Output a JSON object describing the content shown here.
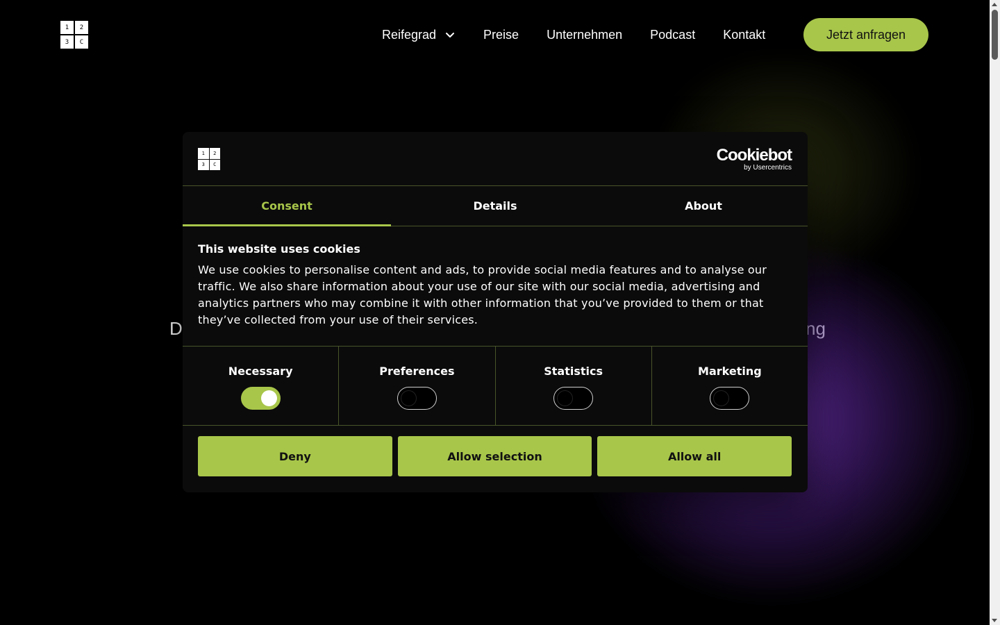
{
  "logo": {
    "cells": [
      "1",
      "2",
      "3",
      "C"
    ]
  },
  "nav": {
    "items": [
      "Reifegrad",
      "Preise",
      "Unternehmen",
      "Podcast",
      "Kontakt"
    ],
    "cta": "Jetzt anfragen"
  },
  "background": {
    "text_left": "D",
    "text_right": "ng"
  },
  "cookie_dialog": {
    "brand": "Cookiebot",
    "brand_by": "by Usercentrics",
    "tabs": [
      "Consent",
      "Details",
      "About"
    ],
    "active_tab": "Consent",
    "title": "This website uses cookies",
    "text": "We use cookies to personalise content and ads, to provide social media features and to analyse our traffic. We also share information about your use of our site with our social media, advertising and analytics partners who may combine it with other information that you’ve provided to them or that they’ve collected from your use of their services.",
    "categories": [
      {
        "label": "Necessary",
        "enabled": true
      },
      {
        "label": "Preferences",
        "enabled": false
      },
      {
        "label": "Statistics",
        "enabled": false
      },
      {
        "label": "Marketing",
        "enabled": false
      }
    ],
    "buttons": [
      "Deny",
      "Allow selection",
      "Allow all"
    ]
  },
  "colors": {
    "accent": "#a8c64a",
    "background": "#000000",
    "dialog": "#0b0b0b",
    "glow": "#622c9e"
  }
}
